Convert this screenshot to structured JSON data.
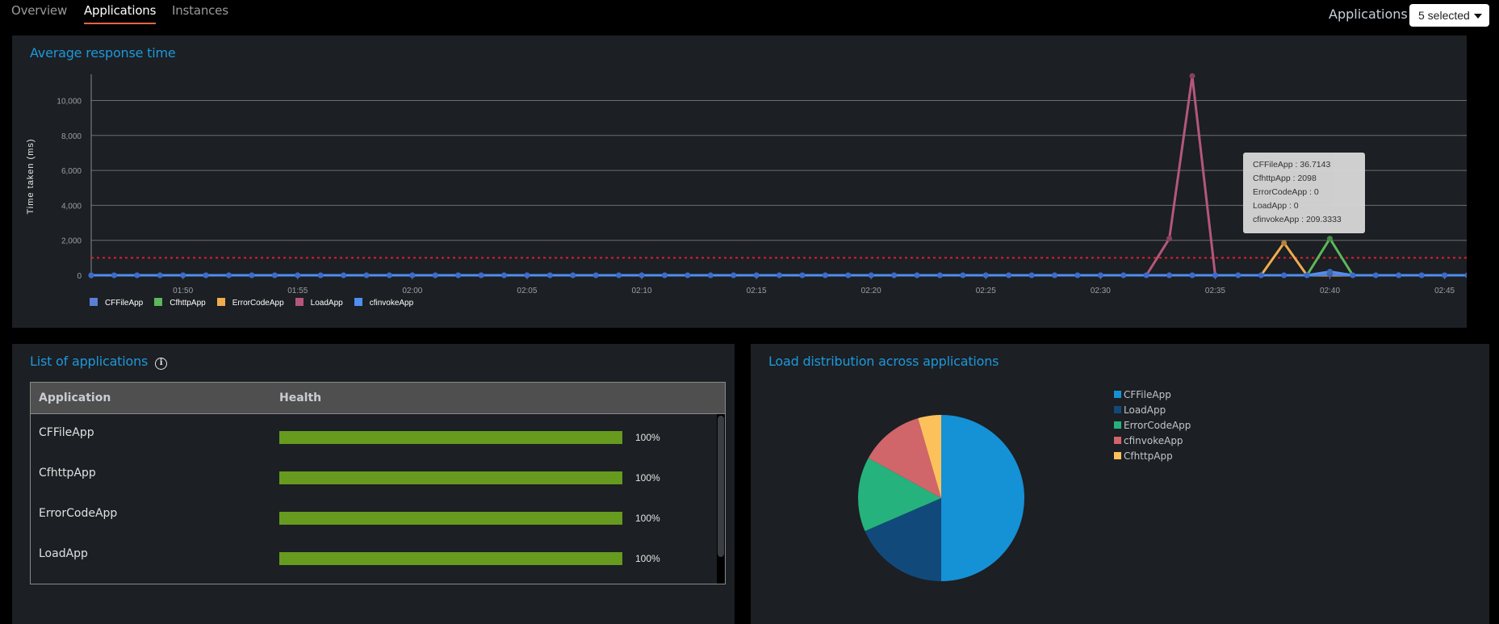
{
  "nav": {
    "tabs": [
      {
        "label": "Overview",
        "active": false
      },
      {
        "label": "Applications",
        "active": true
      },
      {
        "label": "Instances",
        "active": false
      }
    ],
    "filter_label": "Applications",
    "filter_value": "5 selected"
  },
  "response_panel": {
    "title": "Average response time",
    "tooltip": [
      "CFFileApp : 36.7143",
      "CfhttpApp : 2098",
      "ErrorCodeApp : 0",
      "LoadApp : 0",
      "cfinvokeApp : 209.3333"
    ]
  },
  "list_panel": {
    "title": "List of applications",
    "info_icon": "ⓘ",
    "columns": [
      "Application",
      "Health"
    ],
    "rows": [
      {
        "name": "CFFileApp",
        "health": 100,
        "health_label": "100%"
      },
      {
        "name": "CfhttpApp",
        "health": 100,
        "health_label": "100%"
      },
      {
        "name": "ErrorCodeApp",
        "health": 100,
        "health_label": "100%"
      },
      {
        "name": "LoadApp",
        "health": 100,
        "health_label": "100%"
      }
    ]
  },
  "load_panel": {
    "title": "Load distribution across applications"
  },
  "chart_data": [
    {
      "type": "line",
      "title": "Average response time",
      "xlabel": "",
      "ylabel": "Time taken (ms)",
      "ylim": [
        0,
        11500
      ],
      "yticks": [
        0,
        2000,
        4000,
        6000,
        8000,
        10000
      ],
      "ytick_labels": [
        "0",
        "2,000",
        "4,000",
        "6,000",
        "8,000",
        "10,000"
      ],
      "x_start": "01:46",
      "x_end": "02:46",
      "x_step_minutes": 1,
      "xtick_labels": [
        "01:50",
        "01:55",
        "02:00",
        "02:05",
        "02:10",
        "02:15",
        "02:20",
        "02:25",
        "02:30",
        "02:35",
        "02:40",
        "02:45"
      ],
      "threshold": {
        "value": 1000,
        "style": "dotted",
        "color": "#e01e2d"
      },
      "grid": true,
      "legend": "bottom-left",
      "series": [
        {
          "name": "CFFileApp",
          "color": "#5b7fd6",
          "nonzero": {
            "02:40": 36.7143
          }
        },
        {
          "name": "CfhttpApp",
          "color": "#5cb85c",
          "nonzero": {
            "02:40": 2098
          }
        },
        {
          "name": "ErrorCodeApp",
          "color": "#f0ad4e",
          "nonzero": {
            "02:38": 1850
          }
        },
        {
          "name": "LoadApp",
          "color": "#b3587a",
          "nonzero": {
            "02:33": 2100,
            "02:34": 11400
          }
        },
        {
          "name": "cfinvokeApp",
          "color": "#4f8ff0",
          "nonzero": {
            "02:40": 209.3333
          }
        }
      ]
    },
    {
      "type": "pie",
      "title": "Load distribution across applications",
      "legend": "top-right",
      "slices": [
        {
          "label": "CFFileApp",
          "value": 50,
          "color": "#1591d6"
        },
        {
          "label": "LoadApp",
          "value": 18.5,
          "color": "#114a7a"
        },
        {
          "label": "ErrorCodeApp",
          "value": 14.5,
          "color": "#26b27d"
        },
        {
          "label": "cfinvokeApp",
          "value": 12.5,
          "color": "#d0656a"
        },
        {
          "label": "CfhttpApp",
          "value": 4.5,
          "color": "#fdc15c"
        }
      ]
    }
  ]
}
